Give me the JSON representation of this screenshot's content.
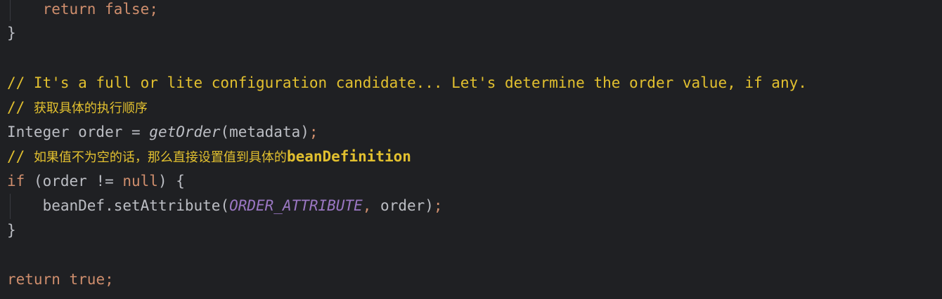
{
  "code": {
    "line1": {
      "indent": "    ",
      "kw": "return",
      "sp": " ",
      "val": "false",
      "semi": ";"
    },
    "line2": {
      "brace": "}"
    },
    "line4": {
      "comment": "// It's a full or lite configuration candidate... Let's determine the order value, if any."
    },
    "line5": {
      "prefix": "// ",
      "text": "获取具体的执行顺序"
    },
    "line6": {
      "type": "Integer order = ",
      "fn": "getOrder",
      "args": "(metadata)",
      "semi": ";"
    },
    "line7": {
      "prefix": "// ",
      "text": "如果值不为空的话，那么直接设置值到具体的",
      "tail": "beanDefinition"
    },
    "line8": {
      "kw": "if",
      "open": " (order != ",
      "null": "null",
      "close": ") {"
    },
    "line9": {
      "indent": "    ",
      "call": "beanDef.setAttribute(",
      "const": "ORDER_ATTRIBUTE",
      "comma": ",",
      "rest": " order)",
      "semi": ";"
    },
    "line10": {
      "brace": "}"
    },
    "line12": {
      "kw": "return",
      "sp": " ",
      "val": "true",
      "semi": ";"
    }
  }
}
